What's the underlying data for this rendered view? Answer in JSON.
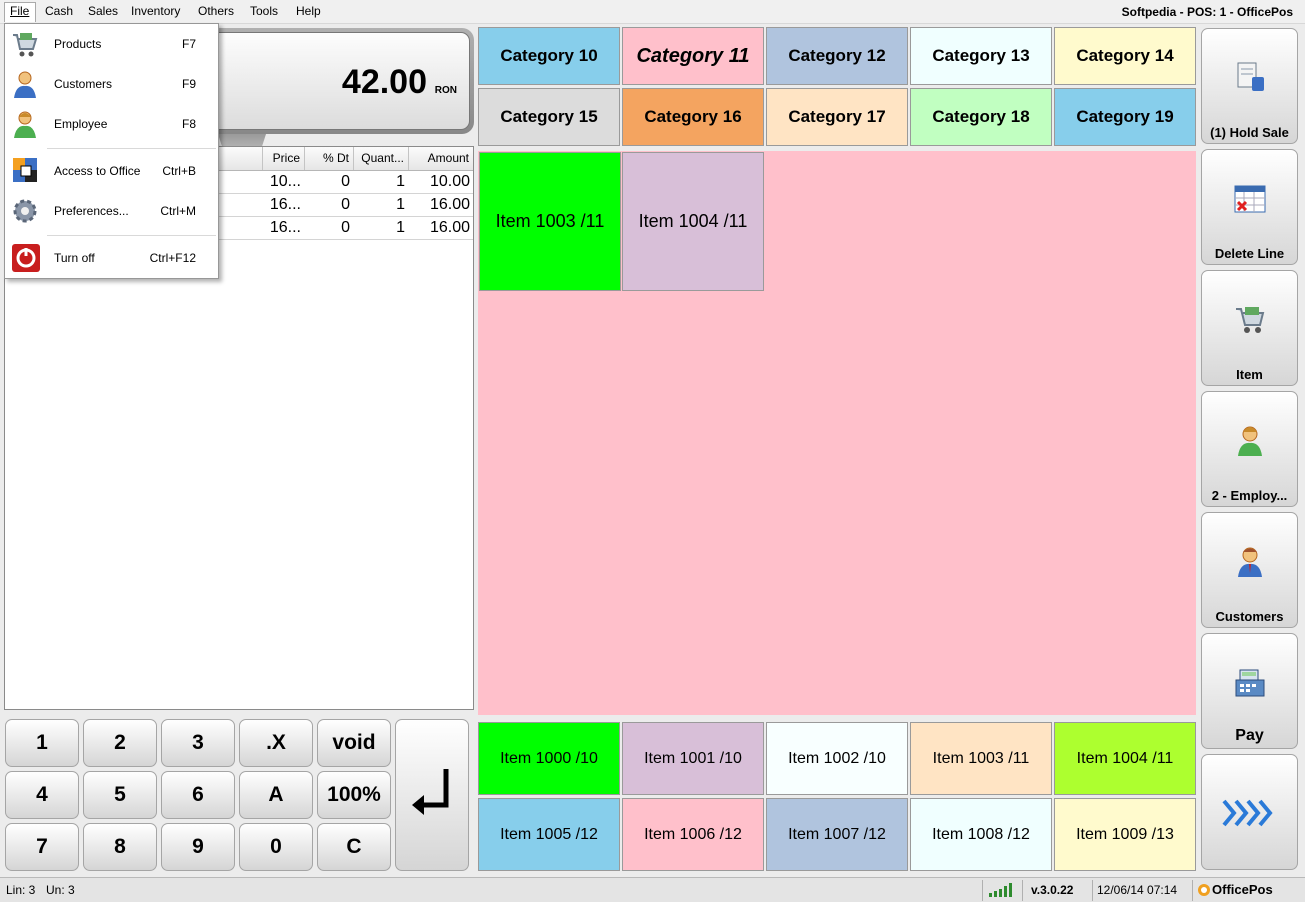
{
  "menubar": {
    "items": [
      "File",
      "Cash",
      "Sales",
      "Inventory",
      "Others",
      "Tools",
      "Help"
    ],
    "title": "Softpedia - POS: 1 - OfficePos"
  },
  "display": {
    "total": "42.00",
    "currency": "RON"
  },
  "grid": {
    "headers": [
      "Price",
      "% Dt",
      "Quant...",
      "Amount"
    ],
    "rows": [
      {
        "price": "10...",
        "discount": "0",
        "quantity": "1",
        "amount": "10.00"
      },
      {
        "price": "16...",
        "discount": "0",
        "quantity": "1",
        "amount": "16.00"
      },
      {
        "price": "16...",
        "discount": "0",
        "quantity": "1",
        "amount": "16.00"
      }
    ]
  },
  "keypad": {
    "keys": [
      "1",
      "2",
      "3",
      ".X",
      "void",
      "4",
      "5",
      "6",
      "A",
      "100%",
      "7",
      "8",
      "9",
      "0",
      "C"
    ],
    "enter_icon": "enter-arrow-icon"
  },
  "categories": [
    {
      "label": "Category 10",
      "color": "#87ceeb"
    },
    {
      "label": "Category 11",
      "color": "#ffc0cb",
      "selected": true
    },
    {
      "label": "Category 12",
      "color": "#b0c4de"
    },
    {
      "label": "Category 13",
      "color": "#f0ffff"
    },
    {
      "label": "Category 14",
      "color": "#fffacd"
    },
    {
      "label": "Category 15",
      "color": "#dcdcdc"
    },
    {
      "label": "Category 16",
      "color": "#f4a460"
    },
    {
      "label": "Category 17",
      "color": "#ffe4c4"
    },
    {
      "label": "Category 18",
      "color": "#c1ffc1"
    },
    {
      "label": "Category 19",
      "color": "#87ceeb"
    }
  ],
  "items_top": [
    {
      "label": "Item 1003 /11",
      "color": "#00ff00"
    },
    {
      "label": "Item 1004 /11",
      "color": "#d8bfd8"
    }
  ],
  "items_bottom": [
    {
      "label": "Item 1000 /10",
      "color": "#00ff00"
    },
    {
      "label": "Item 1001 /10",
      "color": "#d8bfd8"
    },
    {
      "label": "Item 1002 /10",
      "color": "#f8ffff"
    },
    {
      "label": "Item 1003 /11",
      "color": "#ffe4c4"
    },
    {
      "label": "Item 1004 /11",
      "color": "#adff2f"
    },
    {
      "label": "Item 1005 /12",
      "color": "#87ceeb"
    },
    {
      "label": "Item 1006 /12",
      "color": "#ffc0cb"
    },
    {
      "label": "Item 1007 /12",
      "color": "#b0c4de"
    },
    {
      "label": "Item 1008 /12",
      "color": "#f0ffff"
    },
    {
      "label": "Item 1009 /13",
      "color": "#fffacd"
    }
  ],
  "side_buttons": [
    {
      "label": "(1) Hold Sale",
      "icon": "hold-sale-icon"
    },
    {
      "label": "Delete Line",
      "icon": "calendar-delete-icon"
    },
    {
      "label": "Item",
      "icon": "shopping-cart-icon"
    },
    {
      "label": "2 - Employ...",
      "icon": "employee-icon"
    },
    {
      "label": "Customers",
      "icon": "customer-icon"
    },
    {
      "label": "Pay",
      "icon": "cash-register-icon"
    },
    {
      "label": "",
      "icon": "chevrons-right-icon"
    }
  ],
  "status": {
    "lines": "Lin: 3",
    "units": "Un: 3",
    "version": "v.3.0.22",
    "datetime": "12/06/14 07:14",
    "brand": "OfficePos"
  },
  "file_menu": [
    {
      "label": "Products",
      "shortcut": "F7",
      "icon": "products-cart-icon"
    },
    {
      "label": "Customers",
      "shortcut": "F9",
      "icon": "customer-icon"
    },
    {
      "label": "Employee",
      "shortcut": "F8",
      "icon": "employee-icon"
    },
    {
      "label": "Access to Office",
      "shortcut": "Ctrl+B",
      "icon": "office-access-icon"
    },
    {
      "label": "Preferences...",
      "shortcut": "Ctrl+M",
      "icon": "gear-icon"
    },
    {
      "label": "Turn off",
      "shortcut": "Ctrl+F12",
      "icon": "power-icon"
    }
  ]
}
